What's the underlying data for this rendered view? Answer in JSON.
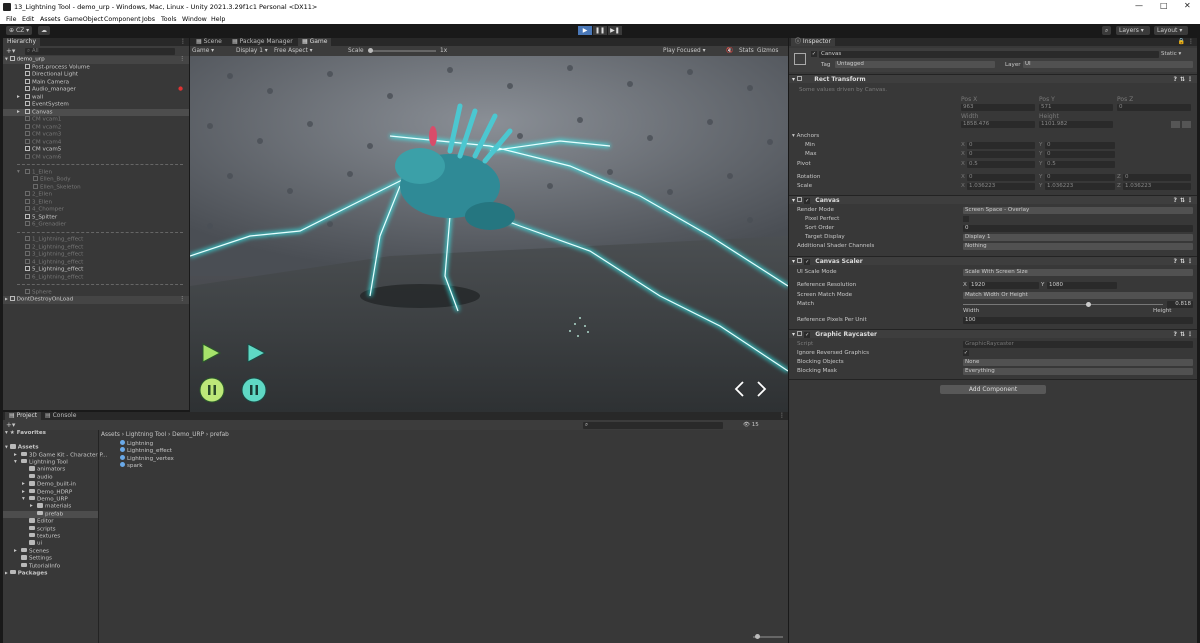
{
  "window": {
    "title": "13_Lightning Tool - demo_urp - Windows, Mac, Linux - Unity 2021.3.29f1c1 Personal <DX11>"
  },
  "menu": [
    "File",
    "Edit",
    "Assets",
    "GameObject",
    "Component",
    "Jobs",
    "Tools",
    "Window",
    "Help"
  ],
  "toolbar": {
    "account": "CZ",
    "layers": "Layers",
    "layout": "Layout"
  },
  "hierarchy": {
    "tab": "Hierarchy",
    "search_placeholder": "All",
    "scene": "demo_urp",
    "items": [
      {
        "label": "Post-process Volume",
        "dim": false
      },
      {
        "label": "Directional Light",
        "dim": false
      },
      {
        "label": "Main Camera",
        "dim": false
      },
      {
        "label": "Audio_manager",
        "dim": false
      },
      {
        "label": "wall",
        "dim": false
      },
      {
        "label": "EventSystem",
        "dim": false
      },
      {
        "label": "Canvas",
        "dim": false,
        "selected": true
      },
      {
        "label": "CM vcam1",
        "dim": true
      },
      {
        "label": "CM vcam2",
        "dim": true
      },
      {
        "label": "CM vcam3",
        "dim": true
      },
      {
        "label": "CM vcam4",
        "dim": true
      },
      {
        "label": "CM vcam5",
        "dim": false
      },
      {
        "label": "CM vcam6",
        "dim": true
      },
      {
        "label": "1_Ellen",
        "dim": true
      },
      {
        "label": "Ellen_Body",
        "dim": true
      },
      {
        "label": "Ellen_Skeleton",
        "dim": true
      },
      {
        "label": "2_Ellen",
        "dim": true
      },
      {
        "label": "3_Ellen",
        "dim": true
      },
      {
        "label": "4_Chomper",
        "dim": true
      },
      {
        "label": "5_Spitter",
        "dim": false
      },
      {
        "label": "6_Grenadier",
        "dim": true
      },
      {
        "label": "1_Lightning_effect",
        "dim": true
      },
      {
        "label": "2_Lightning_effect",
        "dim": true
      },
      {
        "label": "3_Lightning_effect",
        "dim": true
      },
      {
        "label": "4_Lightning_effect",
        "dim": true
      },
      {
        "label": "5_Lightning_effect",
        "dim": false
      },
      {
        "label": "6_Lightning_effect",
        "dim": true
      },
      {
        "label": "Sphere",
        "dim": true
      }
    ],
    "dontdestroy": "DontDestroyOnLoad"
  },
  "sceneTabs": {
    "scene": "Scene",
    "package": "Package Manager",
    "game": "Game"
  },
  "gameBar": {
    "mode": "Game",
    "display": "Display 1",
    "aspect": "Free Aspect",
    "scale_label": "Scale",
    "scale_value": "1x",
    "play_focused": "Play Focused",
    "stats": "Stats",
    "gizmos": "Gizmos"
  },
  "bottomTabs": {
    "project": "Project",
    "console": "Console"
  },
  "project": {
    "favorites": "Favorites",
    "assets": "Assets",
    "tree": [
      "3D Game Kit - Character P...",
      "Lightning Tool",
      "animators",
      "audio",
      "Demo_built-in",
      "Demo_HDRP",
      "Demo_URP",
      "materials",
      "prefab",
      "Editor",
      "scripts",
      "textures",
      "ui",
      "Scenes",
      "Settings",
      "TutorialInfo"
    ],
    "packages": "Packages",
    "breadcrumb": [
      "Assets",
      "Lightning Tool",
      "Demo_URP",
      "prefab"
    ],
    "files": [
      "Lightning",
      "Lightning_effect",
      "Lightning_vertex",
      "spark"
    ],
    "search_count": "15"
  },
  "inspector": {
    "tab": "Inspector",
    "object_name": "Canvas",
    "static": "Static",
    "tag_label": "Tag",
    "tag_value": "Untagged",
    "layer_label": "Layer",
    "layer_value": "UI",
    "rect_transform": "Rect Transform",
    "rect_note": "Some values driven by Canvas.",
    "pos_labels": [
      "Pos X",
      "Pos Y",
      "Pos Z"
    ],
    "pos_values": [
      "963",
      "571",
      "0"
    ],
    "size_labels": [
      "Width",
      "Height"
    ],
    "size_values": [
      "1858.476",
      "1101.982"
    ],
    "anchors": "Anchors",
    "min": "Min",
    "min_x": "0",
    "min_y": "0",
    "max": "Max",
    "max_x": "0",
    "max_y": "0",
    "pivot": "Pivot",
    "pivot_x": "0.5",
    "pivot_y": "0.5",
    "rotation": "Rotation",
    "rot_x": "0",
    "rot_y": "0",
    "rot_z": "0",
    "scale": "Scale",
    "scale_x": "1.036223",
    "scale_y": "1.036223",
    "scale_z": "1.036223",
    "canvas": "Canvas",
    "render_mode_label": "Render Mode",
    "render_mode": "Screen Space - Overlay",
    "pixel_perfect": "Pixel Perfect",
    "sort_order_label": "Sort Order",
    "sort_order": "0",
    "target_display_label": "Target Display",
    "target_display": "Display 1",
    "add_shader_label": "Additional Shader Channels",
    "add_shader": "Nothing",
    "canvas_scaler": "Canvas Scaler",
    "ui_scale_label": "UI Scale Mode",
    "ui_scale": "Scale With Screen Size",
    "ref_res_label": "Reference Resolution",
    "ref_x": "1920",
    "ref_y": "1080",
    "screen_match_label": "Screen Match Mode",
    "screen_match": "Match Width Or Height",
    "match_label": "Match",
    "match_value": "0.818",
    "match_left": "Width",
    "match_right": "Height",
    "ref_ppu_label": "Reference Pixels Per Unit",
    "ref_ppu": "100",
    "graphic_raycaster": "Graphic Raycaster",
    "script_label": "Script",
    "script": "GraphicRaycaster",
    "ignore_rev_label": "Ignore Reversed Graphics",
    "blocking_obj_label": "Blocking Objects",
    "blocking_obj": "None",
    "blocking_mask_label": "Blocking Mask",
    "blocking_mask": "Everything",
    "add_component": "Add Component"
  }
}
